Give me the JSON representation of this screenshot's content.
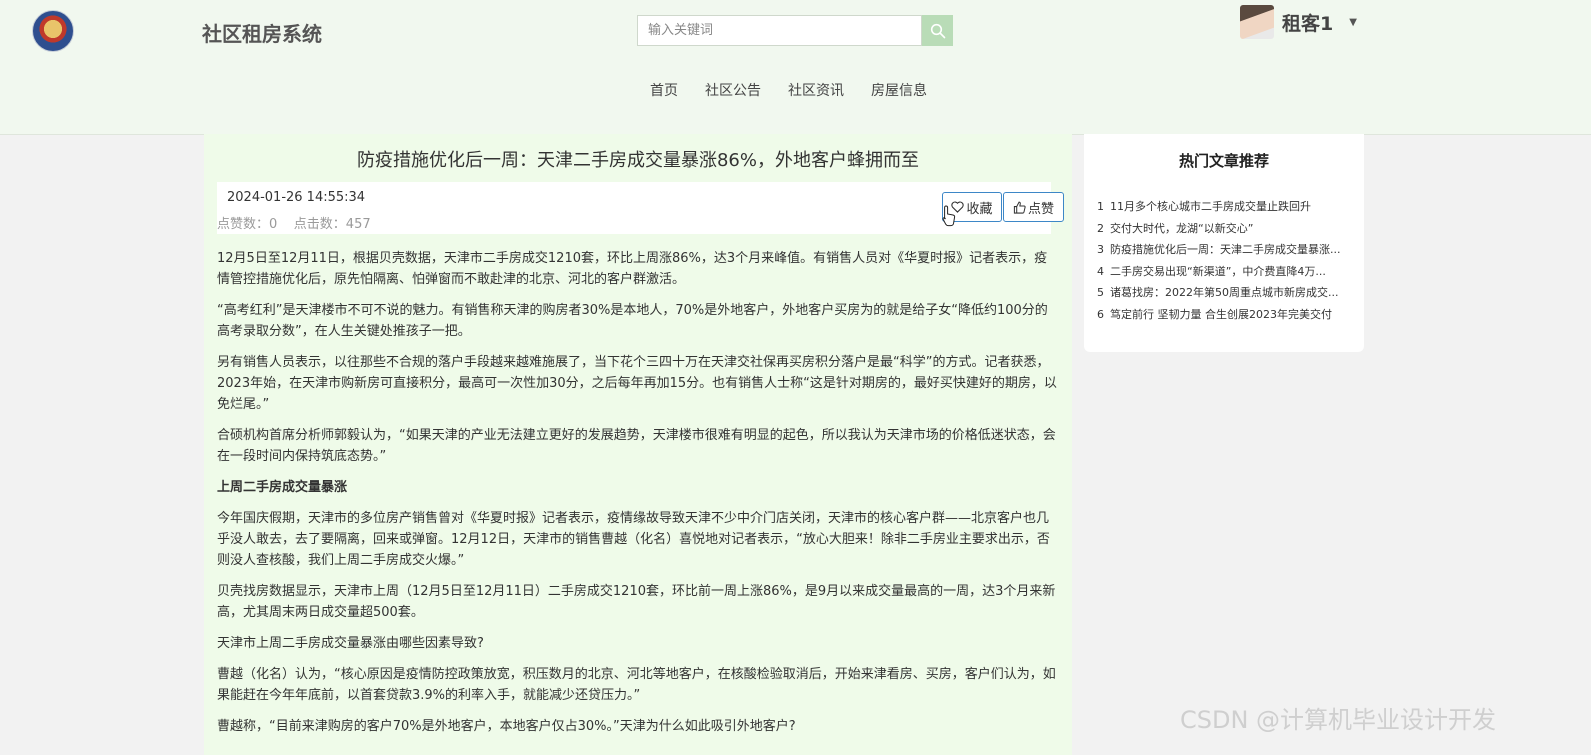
{
  "header": {
    "site_title": "社区租房系统",
    "search_placeholder": "输入关键词",
    "user_name": "租客1",
    "nav": [
      "首页",
      "社区公告",
      "社区资讯",
      "房屋信息"
    ]
  },
  "article": {
    "title": "防疫措施优化后一周：天津二手房成交量暴涨86%，外地客户蜂拥而至",
    "date": "2024-01-26 14:55:34",
    "stats": "点赞数：0    点击数：457",
    "favorite_label": "收藏",
    "like_label": "点赞",
    "paragraphs": [
      "12月5日至12月11日，根据贝壳数据，天津市二手房成交1210套，环比上周涨86%，达3个月来峰值。有销售人员对《华夏时报》记者表示，疫情管控措施优化后，原先怕隔离、怕弹窗而不敢赴津的北京、河北的客户群激活。",
      "“高考红利”是天津楼市不可不说的魅力。有销售称天津的购房者30%是本地人，70%是外地客户，外地客户买房为的就是给子女“降低约100分的高考录取分数”，在人生关键处推孩子一把。",
      "另有销售人员表示，以往那些不合规的落户手段越来越难施展了，当下花个三四十万在天津交社保再买房积分落户是最“科学”的方式。记者获悉，2023年始，在天津市购新房可直接积分，最高可一次性加30分，之后每年再加15分。也有销售人士称“这是针对期房的，最好买快建好的期房，以免烂尾。”",
      "合硕机构首席分析师郭毅认为，“如果天津的产业无法建立更好的发展趋势，天津楼市很难有明显的起色，所以我认为天津市场的价格低迷状态，会在一段时间内保持筑底态势。”"
    ],
    "subheading": "上周二手房成交量暴涨",
    "paragraphs2": [
      "今年国庆假期，天津市的多位房产销售曾对《华夏时报》记者表示，疫情缘故导致天津不少中介门店关闭，天津市的核心客户群——北京客户也几乎没人敢去，去了要隔离，回来或弹窗。12月12日，天津市的销售曹越（化名）喜悦地对记者表示，“放心大胆来！除非二手房业主要求出示，否则没人查核酸，我们上周二手房成交火爆。”",
      "贝壳找房数据显示，天津市上周（12月5日至12月11日）二手房成交1210套，环比前一周上涨86%，是9月以来成交量最高的一周，达3个月来新高，尤其周末两日成交量超500套。",
      "天津市上周二手房成交量暴涨由哪些因素导致?",
      "曹越（化名）认为，“核心原因是疫情防控政策放宽，积压数月的北京、河北等地客户，在核酸检验取消后，开始来津看房、买房，客户们认为，如果能赶在今年年底前，以首套贷款3.9%的利率入手，就能减少还贷压力。”",
      "曹越称，“目前来津购房的客户70%是外地客户，本地客户仅占30%。”天津为什么如此吸引外地客户?"
    ]
  },
  "sidebar": {
    "title": "热门文章推荐",
    "items": [
      {
        "num": "1",
        "text": "11月多个核心城市二手房成交量止跌回升"
      },
      {
        "num": "2",
        "text": "交付大时代，龙湖“以新交心”"
      },
      {
        "num": "3",
        "text": "防疫措施优化后一周：天津二手房成交量暴涨..."
      },
      {
        "num": "4",
        "text": "二手房交易出现“新渠道”，中介费直降4万..."
      },
      {
        "num": "5",
        "text": "诸葛找房：2022年第50周重点城市新房成交..."
      },
      {
        "num": "6",
        "text": "笃定前行 坚韧力量 合生创展2023年完美交付"
      }
    ]
  },
  "watermark": "CSDN @计算机毕业设计开发"
}
